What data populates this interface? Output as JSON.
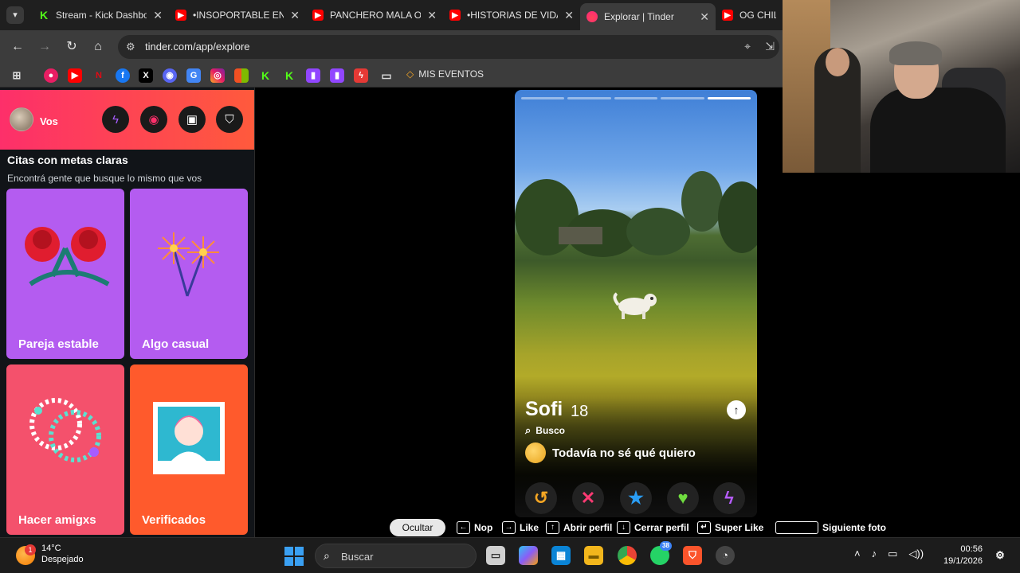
{
  "browser": {
    "tabs": [
      {
        "title": "Stream - Kick Dashbo",
        "icon": "kick-icon"
      },
      {
        "title": "•INSOPORTABLE EN I",
        "icon": "youtube-icon"
      },
      {
        "title": "PANCHERO MALA O",
        "icon": "youtube-icon"
      },
      {
        "title": "•HISTORIAS DE VIDA",
        "icon": "youtube-icon"
      },
      {
        "title": "Explorar | Tinder",
        "icon": "tinder-icon",
        "active": true
      },
      {
        "title": "OG CHILL",
        "icon": "youtube-icon"
      }
    ],
    "url": "tinder.com/app/explore",
    "bookmarks_folder": "MIS EVENTOS"
  },
  "sidebar": {
    "user_label": "Vos",
    "section_title": "Citas con metas claras",
    "section_subtitle": "Encontrá gente que busque lo mismo que vos",
    "cards": [
      {
        "label": "Pareja estable",
        "color": "#b45cf0"
      },
      {
        "label": "Algo casual",
        "color": "#b45cf0"
      },
      {
        "label": "Hacer amigxs",
        "color": "#f4516c"
      },
      {
        "label": "Verificados",
        "color": "#ff5a2c"
      }
    ]
  },
  "profile": {
    "name": "Sofi",
    "age": "18",
    "looking_for_label": "Busco",
    "goal": "Todavía no sé qué quiero",
    "photo_count": 5,
    "current_photo": 5
  },
  "hints": {
    "hide": "Ocultar",
    "items": [
      {
        "key": "←",
        "label": "Nop"
      },
      {
        "key": "→",
        "label": "Like"
      },
      {
        "key": "↑",
        "label": "Abrir perfil"
      },
      {
        "key": "↓",
        "label": "Cerrar perfil"
      },
      {
        "key": "↵",
        "label": "Super Like"
      },
      {
        "key": "",
        "label": "Siguiente foto"
      }
    ]
  },
  "taskbar": {
    "weather_temp": "14°C",
    "weather_desc": "Despejado",
    "weather_badge": "1",
    "search_placeholder": "Buscar",
    "whatsapp_badge": "38",
    "time": "00:56",
    "date": "19/1/2026"
  }
}
